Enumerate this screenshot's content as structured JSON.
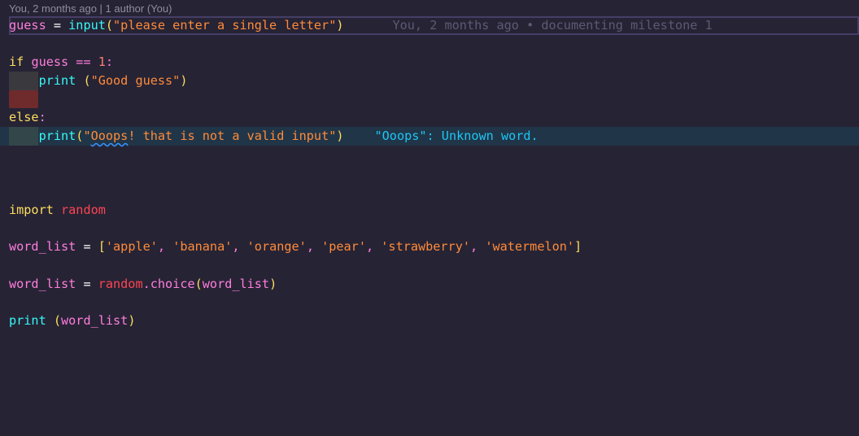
{
  "codelens": "You, 2 months ago | 1 author (You)",
  "blame": "You, 2 months ago • documenting milestone 1",
  "diagnostic": "\"Ooops\": Unknown word.",
  "lines": {
    "l1": {
      "a": "guess",
      "b": " = ",
      "c": "input",
      "d": "(",
      "e": "\"please enter a single letter\"",
      "f": ")"
    },
    "l3": {
      "a": "if ",
      "b": "guess",
      "c": " == ",
      "d": "1",
      ":": ":"
    },
    "l4": {
      "a": "    ",
      "b": "print",
      "c": " (",
      "d": "\"Good guess\"",
      "e": ")"
    },
    "l6": {
      "a": "else",
      "b": ":"
    },
    "l7": {
      "a": "    ",
      "b": "print",
      "c": "(",
      "d": "\"",
      "e": "Ooops",
      "f": "! that is not a valid input\"",
      "g": ")"
    },
    "l11": {
      "a": "import ",
      "b": "random"
    },
    "l13": {
      "a": "word_list",
      "b": " = ",
      "c": "[",
      "d": "'apple'",
      "e": ", ",
      "f": "'banana'",
      "g": "'orange'",
      "h": "'pear'",
      "i": "'strawberry'",
      "j": "'watermelon'",
      "k": "]"
    },
    "l15": {
      "a": "word_list",
      "b": " = ",
      "c": "random",
      "d": ".choice",
      "e": "(",
      "f": "word_list",
      "g": ")"
    },
    "l17": {
      "a": "print",
      "b": " (",
      "c": "word_list",
      "d": ")"
    }
  },
  "colors": {
    "background": "#262335",
    "keyword": "#fede5d",
    "string": "#ff8b39",
    "function": "#36f9f6",
    "variable": "#ff7edb",
    "module": "#fe4450"
  }
}
